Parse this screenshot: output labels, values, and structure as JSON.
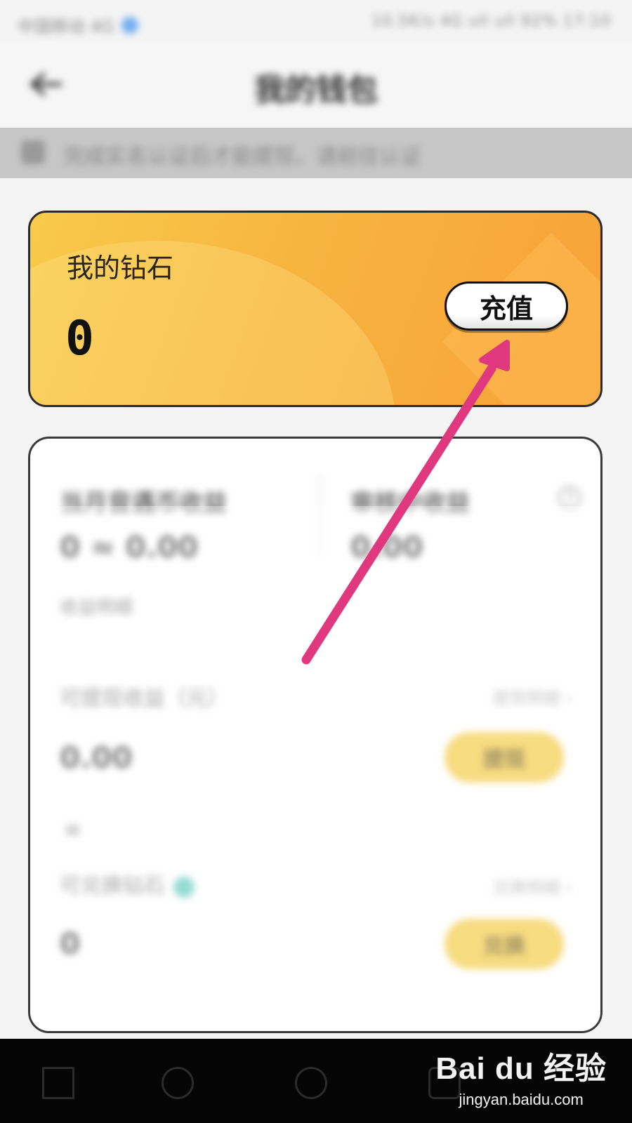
{
  "status_bar": {
    "carrier": "中国移动 4G",
    "right_text": "10.5K/s 4G  ull  ull  92%  17:10"
  },
  "app_bar": {
    "title": "我的钱包"
  },
  "notice": {
    "text": "完成实名认证后才能提现，请前往认证"
  },
  "diamond_card": {
    "title": "我的钻石",
    "value": "0",
    "recharge_label": "充值"
  },
  "earnings": {
    "monthly_label": "当月音遇币收益",
    "reviewing_label": "审核中收益",
    "help_icon": "question-circle-icon",
    "monthly_value": "0 ≈ 0.00",
    "reviewing_value": "0.00",
    "monthly_sub": "收益明细",
    "withdrawable_label": "可提现收益（元）",
    "withdrawable_right": "提现明细 ›",
    "withdrawable_value": "0.00",
    "withdraw_button": "提现",
    "divider_symbol": "≡",
    "exchangeable_label": "可兑换钻石",
    "exchangeable_right": "兑换明细 ›",
    "exchangeable_value": "0",
    "exchange_button": "兑换"
  },
  "nav_bar": {
    "icons": [
      "menu-icon",
      "home-icon",
      "circle-icon",
      "back-icon"
    ]
  },
  "watermark": {
    "logo": "Bai du 经验",
    "url": "jingyan.baidu.com"
  },
  "annotation": {
    "color": "#e0387f"
  }
}
